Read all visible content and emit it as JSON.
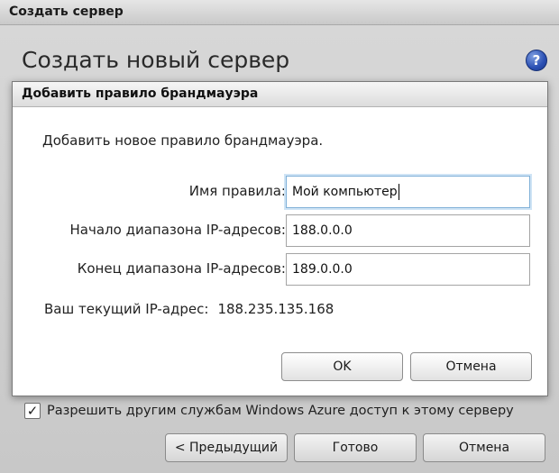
{
  "outer_window": {
    "title": "Создать сервер",
    "heading": "Создать новый сервер",
    "help_icon_glyph": "?",
    "allow_checkbox": {
      "checked": true,
      "glyph": "✓",
      "label": "Разрешить другим службам Windows Azure доступ к этому серверу"
    },
    "buttons": {
      "previous": "< Предыдущий",
      "done": "Готово",
      "cancel": "Отмена"
    }
  },
  "dialog": {
    "title": "Добавить правило брандмауэра",
    "intro": "Добавить новое правило брандмауэра.",
    "fields": {
      "rule_name": {
        "label": "Имя правила:",
        "value": "Мой компьютер"
      },
      "ip_start": {
        "label": "Начало диапазона IP-адресов:",
        "value": "188.0.0.0"
      },
      "ip_end": {
        "label": "Конец диапазона IP-адресов:",
        "value": "189.0.0.0"
      }
    },
    "current_ip": {
      "label": "Ваш текущий IP-адрес:",
      "value": "188.235.135.168"
    },
    "buttons": {
      "ok": "OK",
      "cancel": "Отмена"
    }
  },
  "icons": {
    "help": "help-icon",
    "checkmark": "checkmark-icon"
  },
  "colors": {
    "help_icon": "#2a4fb3",
    "focus_ring": "#7fb0d8"
  }
}
